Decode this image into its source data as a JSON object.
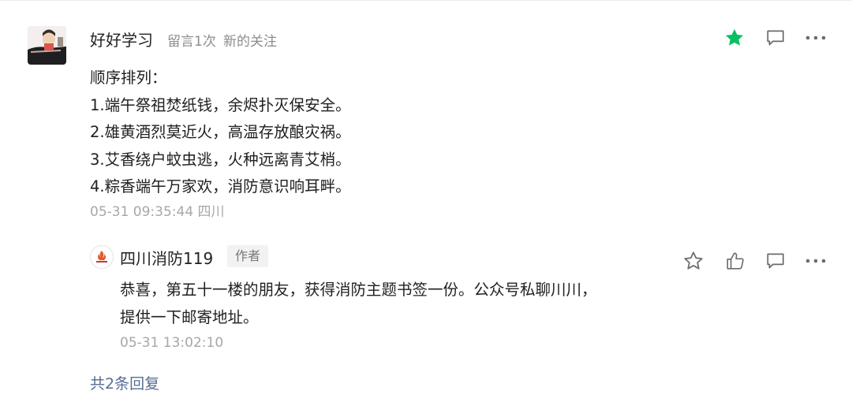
{
  "comment": {
    "nickname": "好好学习",
    "meta_count": "留言1次",
    "meta_follow": "新的关注",
    "lines": [
      "顺序排列：",
      "1.端午祭祖焚纸钱，余烬扑灭保安全。",
      "2.雄黄酒烈莫近火，高温存放酿灾祸。",
      "3.艾香绕户蚊虫逃，火种远离青艾梢。",
      "4.粽香端午万家欢，消防意识响耳畔。"
    ],
    "timestamp": "05-31 09:35:44 四川"
  },
  "reply": {
    "nickname": "四川消防119",
    "badge": "作者",
    "lines": [
      "恭喜，第五十一楼的朋友，获得消防主题书签一份。公众号私聊川川，",
      "提供一下邮寄地址。"
    ],
    "timestamp": "05-31 13:02:10"
  },
  "footer": {
    "total_replies": "共2条回复"
  },
  "colors": {
    "star_active": "#07c160",
    "icon_gray": "#6b6b6b",
    "link_blue": "#576b95"
  }
}
